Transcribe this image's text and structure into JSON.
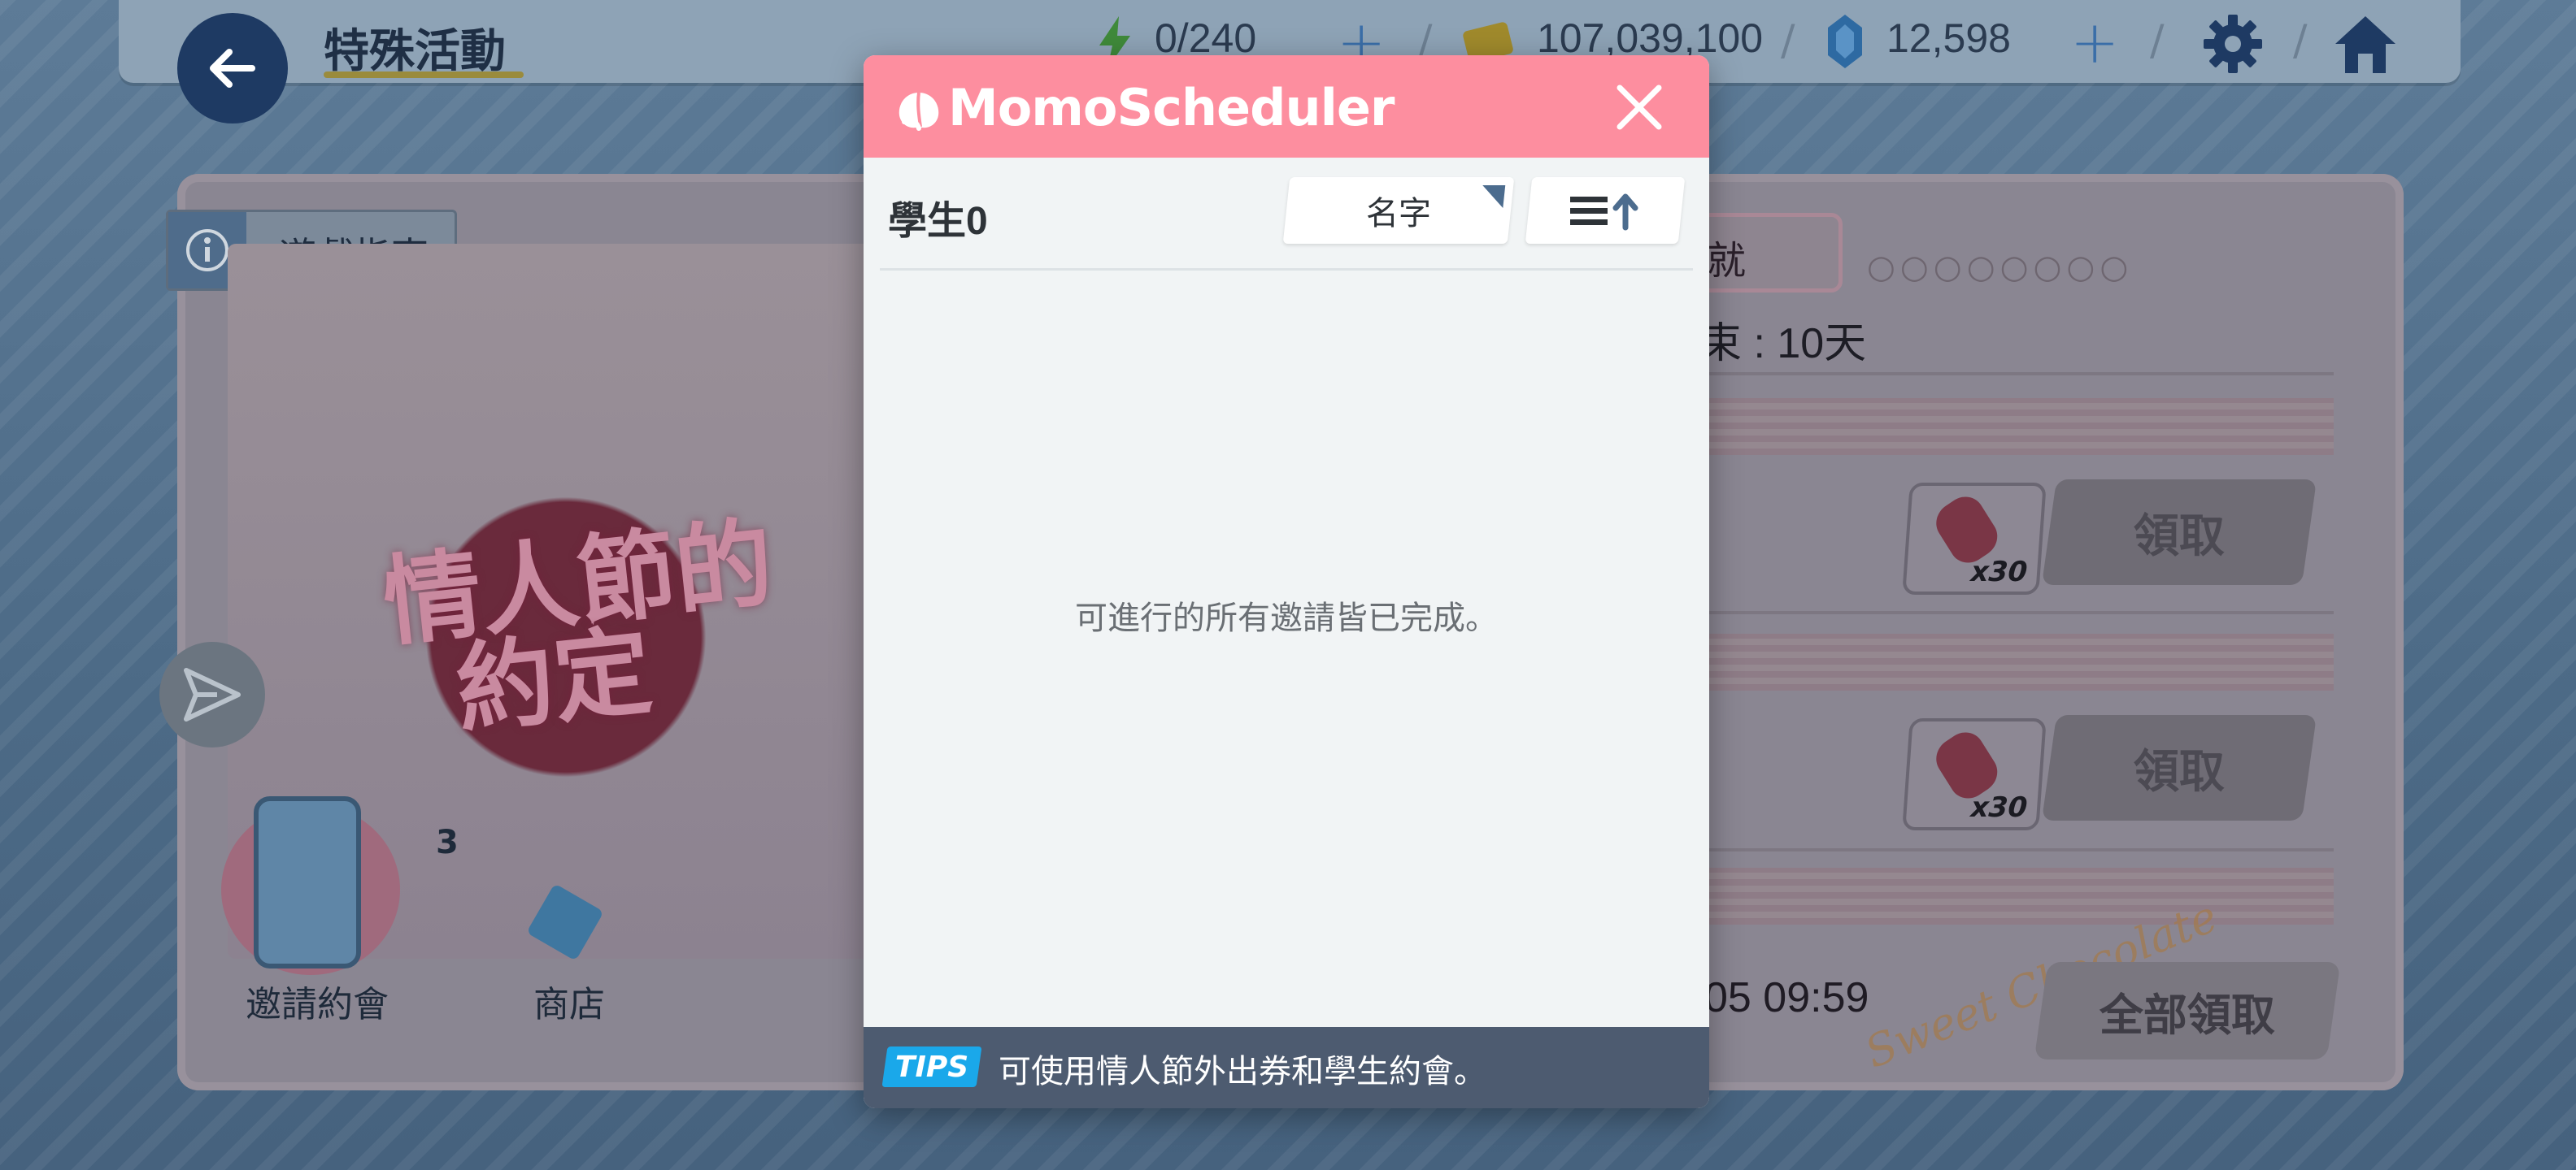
{
  "background_game": {
    "page_title": "特殊活動",
    "resources": {
      "ap": "0/240",
      "credits": "107,039,100",
      "pyroxene": "12,598"
    },
    "guide_label": "遊戲指南",
    "event_art_title_line1": "情人節的",
    "event_art_title_line2": "約定",
    "ticket_count": "3",
    "nav": {
      "invite_label": "邀請約會",
      "shop_label": "商店"
    },
    "right_panel": {
      "tab_partial": "就",
      "time_left_partial": "束 : 10天",
      "rewards": [
        {
          "qty": "x30",
          "claim_label": "領取"
        },
        {
          "qty": "x30",
          "claim_label": "領取"
        }
      ],
      "deadline_partial": "05 09:59",
      "decor_text": "Sweet Chocolate",
      "claim_all_label": "全部領取"
    }
  },
  "modal": {
    "title": "MomoScheduler",
    "students_label": "學生",
    "students_count": "0",
    "sort_value": "名字",
    "empty_message": "可進行的所有邀請皆已完成。",
    "tips_badge": "TIPS",
    "tips_text": "可使用情人節外出券和學生約會。"
  },
  "colors": {
    "modal_header": "#fd8e9f",
    "modal_body": "#f1f4f5",
    "modal_footer": "#4d5b70",
    "tips_badge": "#1aa8ea",
    "sort_corner": "#4c6c8e"
  },
  "icons": [
    "back-arrow-icon",
    "ap-bolt-icon",
    "credit-icon",
    "pyroxene-icon",
    "gear-icon",
    "home-icon",
    "info-icon",
    "send-icon",
    "peach-logo-icon",
    "close-icon",
    "sort-order-icon"
  ]
}
